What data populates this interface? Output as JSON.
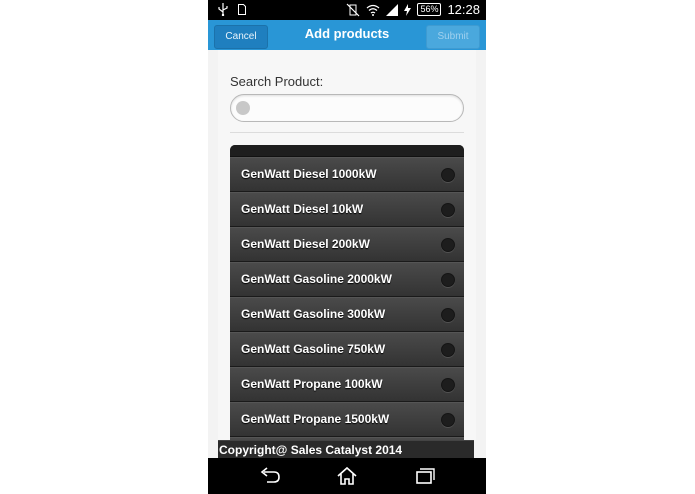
{
  "status_bar": {
    "battery": "56%",
    "time": "12:28",
    "icons": [
      "usb-icon",
      "sim-icon",
      "vibrate-off-icon",
      "wifi-icon",
      "signal-icon",
      "charging-icon"
    ]
  },
  "header": {
    "cancel_label": "Cancel",
    "title": "Add products",
    "submit_label": "Submit"
  },
  "search": {
    "label": "Search Product:",
    "value": "",
    "placeholder": ""
  },
  "products": [
    {
      "label": "GenWatt Diesel 1000kW",
      "selected": false
    },
    {
      "label": "GenWatt Diesel 10kW",
      "selected": false
    },
    {
      "label": "GenWatt Diesel 200kW",
      "selected": false
    },
    {
      "label": "GenWatt Gasoline 2000kW",
      "selected": false
    },
    {
      "label": "GenWatt Gasoline 300kW",
      "selected": false
    },
    {
      "label": "GenWatt Gasoline 750kW",
      "selected": false
    },
    {
      "label": "GenWatt Propane 100kW",
      "selected": false
    },
    {
      "label": "GenWatt Propane 1500kW",
      "selected": false
    }
  ],
  "footer": {
    "text": "Copyright@ Sales Catalyst 2014"
  },
  "nav_bar": {
    "icons": [
      "back-icon",
      "home-icon",
      "recent-apps-icon"
    ]
  },
  "colors": {
    "header_bg": "#2996d6",
    "list_bg": "#333333",
    "status_bar_bg": "#000000"
  }
}
